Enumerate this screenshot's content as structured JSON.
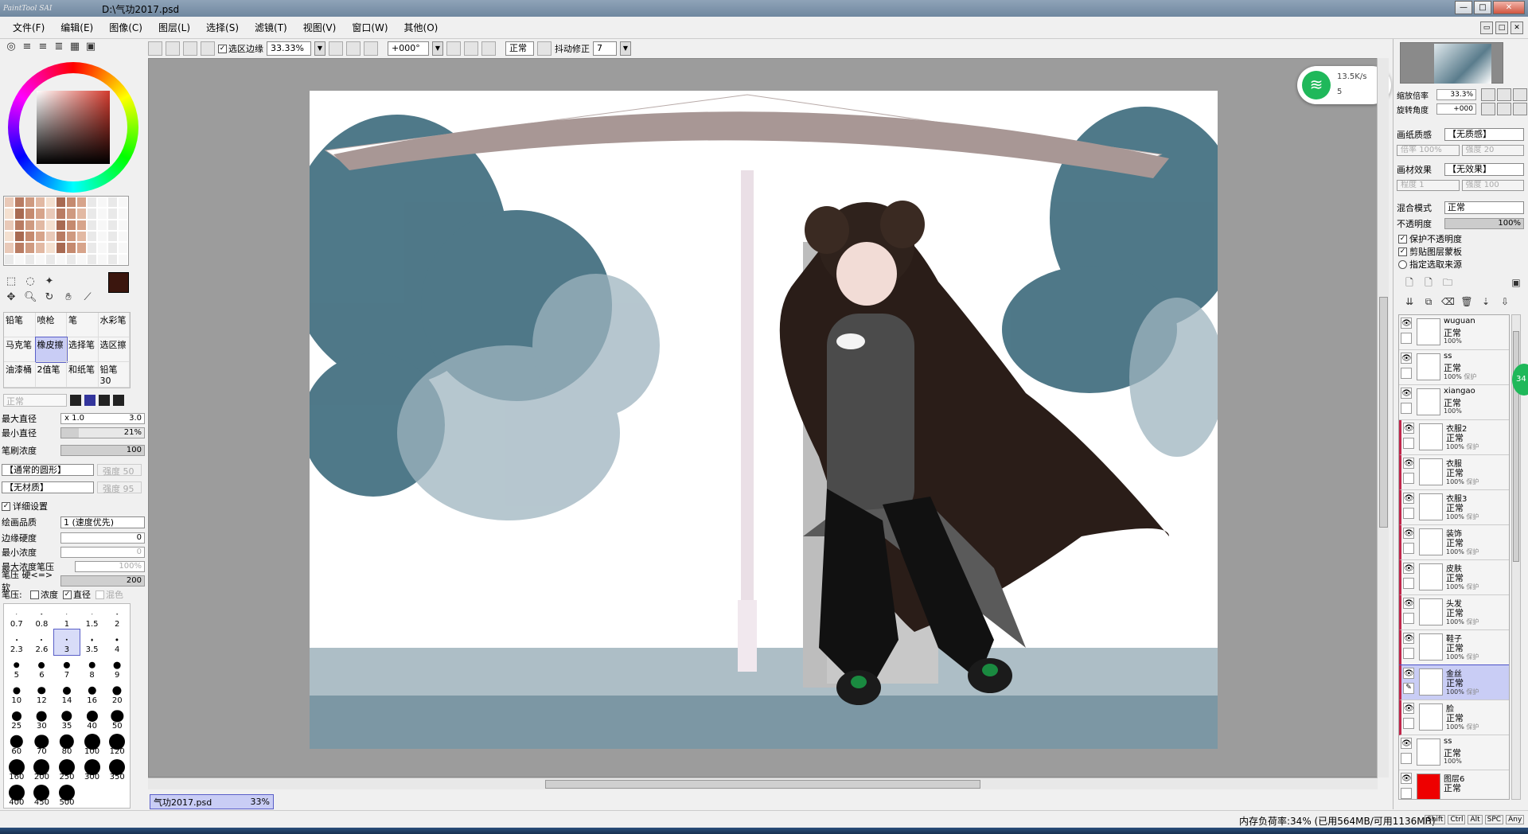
{
  "title": {
    "app": "PaintTool SAI",
    "file": "D:\\气功2017.psd"
  },
  "window_buttons": [
    "—",
    "□",
    "✕"
  ],
  "menu": [
    "文件(F)",
    "编辑(E)",
    "图像(C)",
    "图层(L)",
    "选择(S)",
    "滤镜(T)",
    "视图(V)",
    "窗口(W)",
    "其他(O)"
  ],
  "toolbar": {
    "sel_edge_label": "选区边缘",
    "zoom": "33.33%",
    "rotate": "+000°",
    "mode": "正常",
    "stabilizer_label": "抖动修正",
    "stabilizer_value": "7"
  },
  "brushes": [
    {
      "name": "铅笔"
    },
    {
      "name": "喷枪"
    },
    {
      "name": "笔"
    },
    {
      "name": "水彩笔"
    },
    {
      "name": "马克笔"
    },
    {
      "name": "橡皮擦",
      "selected": true
    },
    {
      "name": "选择笔"
    },
    {
      "name": "选区擦"
    },
    {
      "name": "油漆桶"
    },
    {
      "name": "2值笔"
    },
    {
      "name": "和纸笔"
    },
    {
      "name": "铅笔30"
    }
  ],
  "brush_props": {
    "blend": "正常",
    "max_size_label": "最大直径",
    "max_size_mult": "x 1.0",
    "max_size_val": "3.0",
    "min_size_label": "最小直径",
    "min_size_val": "21%",
    "min_size_pct": 21,
    "density_label": "笔刷浓度",
    "density_val": "100",
    "density_pct": 100,
    "shape": "【通常的圆形】",
    "shape_strength_label": "强度",
    "shape_strength": "50",
    "texture": "【无材质】",
    "texture_strength_label": "强度",
    "texture_strength": "95",
    "detail_label": "详细设置",
    "quality_label": "绘画品质",
    "quality_val": "1 (速度优先)",
    "edge_label": "边缘硬度",
    "edge_val": "0",
    "min_density_label": "最小浓度",
    "min_density_val": "0",
    "max_pressure_label": "最大浓度笔压",
    "max_pressure_val": "100%",
    "pressure_label": "笔压 硬<=>软",
    "pressure_val": "200",
    "pressure2_label": "笔压:",
    "opt_density": "浓度",
    "opt_size": "直径",
    "opt_mix": "混色"
  },
  "brush_sizes": [
    "0.7",
    "0.8",
    "1",
    "1.5",
    "2",
    "2.3",
    "2.6",
    "3",
    "3.5",
    "4",
    "5",
    "6",
    "7",
    "8",
    "9",
    "10",
    "12",
    "14",
    "16",
    "20",
    "25",
    "30",
    "35",
    "40",
    "50",
    "60",
    "70",
    "80",
    "100",
    "120",
    "160",
    "200",
    "250",
    "300",
    "350",
    "400",
    "450",
    "500"
  ],
  "selected_size": "3",
  "doc_tab": {
    "name": "气功2017.psd",
    "zoom": "33%"
  },
  "status": {
    "memory": "内存负荷率:34% (已用564MB/可用1136MB)",
    "keys": [
      "Shift",
      "Ctrl",
      "Alt",
      "SPC",
      "Any"
    ]
  },
  "wifi": {
    "speed": "13.5K/s",
    "count": "5"
  },
  "bubble": "34",
  "navigator": {
    "zoom_label": "缩放倍率",
    "zoom": "33.3%",
    "angle_label": "旋转角度",
    "angle": "+000"
  },
  "paper": {
    "texture_label": "画纸质感",
    "texture": "【无质感】",
    "scale_label": "倍率",
    "scale": "100%",
    "strength_label": "强度",
    "strength": "20",
    "effect_label": "画材效果",
    "effect": "【无效果】",
    "degree_label": "程度",
    "degree": "1",
    "effect_strength_label": "强度",
    "effect_strength": "100"
  },
  "layer_props": {
    "blend_label": "混合模式",
    "blend": "正常",
    "opacity_label": "不透明度",
    "opacity": "100%",
    "protect_label": "保护不透明度",
    "clip_label": "剪贴图层蒙板",
    "source_label": "指定选取来源"
  },
  "layers": [
    {
      "name": "wuguan",
      "mode": "正常",
      "opacity": "100%",
      "protect": ""
    },
    {
      "name": "ss",
      "mode": "正常",
      "opacity": "100%",
      "protect": "保护"
    },
    {
      "name": "xiangao",
      "mode": "正常",
      "opacity": "100%",
      "protect": ""
    },
    {
      "name": "衣服2",
      "mode": "正常",
      "opacity": "100%",
      "protect": "保护",
      "clip": true
    },
    {
      "name": "衣服",
      "mode": "正常",
      "opacity": "100%",
      "protect": "保护",
      "clip": true
    },
    {
      "name": "衣服3",
      "mode": "正常",
      "opacity": "100%",
      "protect": "保护",
      "clip": true
    },
    {
      "name": "装饰",
      "mode": "正常",
      "opacity": "100%",
      "protect": "保护",
      "clip": true
    },
    {
      "name": "皮肤",
      "mode": "正常",
      "opacity": "100%",
      "protect": "保护",
      "clip": true
    },
    {
      "name": "头发",
      "mode": "正常",
      "opacity": "100%",
      "protect": "保护",
      "clip": true
    },
    {
      "name": "鞋子",
      "mode": "正常",
      "opacity": "100%",
      "protect": "保护",
      "clip": true
    },
    {
      "name": "金丝",
      "mode": "正常",
      "opacity": "100%",
      "protect": "保护",
      "clip": true,
      "selected": true
    },
    {
      "name": "脸",
      "mode": "正常",
      "opacity": "100%",
      "protect": "保护",
      "clip": true
    },
    {
      "name": "ss",
      "mode": "正常",
      "opacity": "100%",
      "protect": ""
    },
    {
      "name": "图层6",
      "mode": "正常",
      "opacity": "",
      "protect": "",
      "red": true
    }
  ]
}
